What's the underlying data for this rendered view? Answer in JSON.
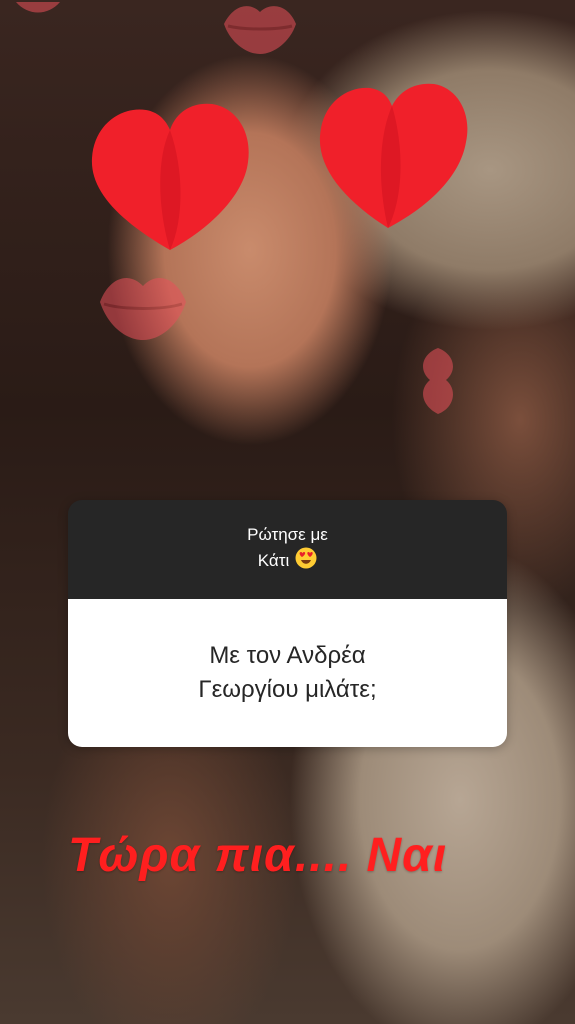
{
  "question_sticker": {
    "title_line1": "Ρώτησε με",
    "title_line2": "Κάτι",
    "emoji": "heart-eyes-emoji",
    "question_line1": "Με τον Ανδρέα",
    "question_line2": "Γεωργίου μιλάτε;"
  },
  "answer": {
    "text": "Τώρα πια.... Ναι",
    "color": "#ff1f1f"
  },
  "colors": {
    "heart": "#f0202a",
    "kiss": "#e8505a",
    "card_header": "#262626",
    "card_body": "#ffffff"
  }
}
